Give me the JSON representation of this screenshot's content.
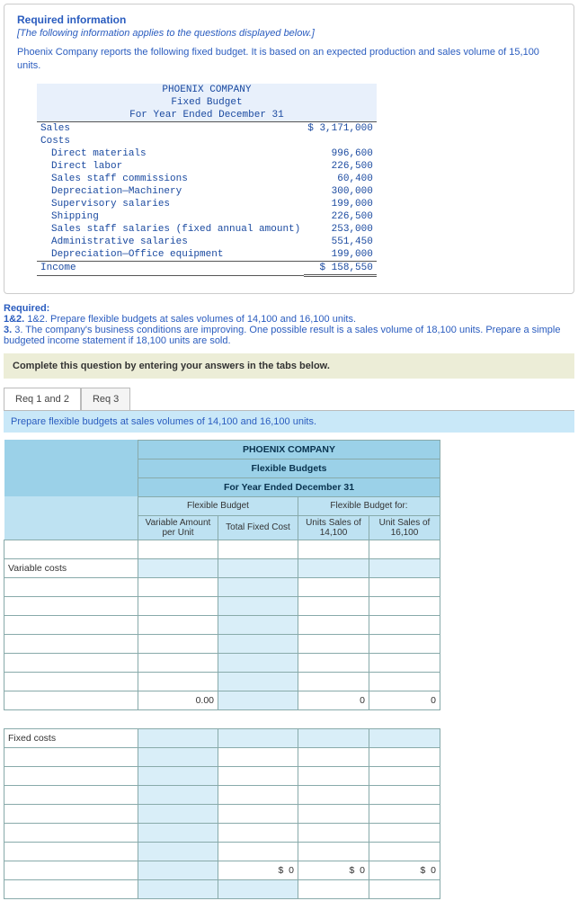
{
  "header": {
    "title": "Required information",
    "note": "[The following information applies to the questions displayed below.]",
    "intro": "Phoenix Company reports the following fixed budget. It is based on an expected production and sales volume of 15,100 units."
  },
  "fixed_budget": {
    "company": "PHOENIX COMPANY",
    "title": "Fixed Budget",
    "period": "For Year Ended December 31",
    "lines": {
      "sales_label": "Sales",
      "sales_amount": "$ 3,171,000",
      "costs_label": "Costs",
      "direct_materials": "Direct materials",
      "direct_materials_amt": "996,600",
      "direct_labor": "Direct labor",
      "direct_labor_amt": "226,500",
      "sales_staff_comm": "Sales staff commissions",
      "sales_staff_comm_amt": "60,400",
      "dep_machinery": "Depreciation—Machinery",
      "dep_machinery_amt": "300,000",
      "supervisory": "Supervisory salaries",
      "supervisory_amt": "199,000",
      "shipping": "Shipping",
      "shipping_amt": "226,500",
      "sales_staff_sal": "Sales staff salaries (fixed annual amount)",
      "sales_staff_sal_amt": "253,000",
      "admin_sal": "Administrative salaries",
      "admin_sal_amt": "551,450",
      "dep_office": "Depreciation—Office equipment",
      "dep_office_amt": "199,000",
      "income_label": "Income",
      "income_amt": "$ 158,550"
    }
  },
  "required": {
    "heading": "Required:",
    "line1": "1&2. Prepare flexible budgets at sales volumes of 14,100 and 16,100 units.",
    "line2": "3. The company's business conditions are improving. One possible result is a sales volume of 18,100 units. Prepare a simple budgeted income statement if 18,100 units are sold."
  },
  "instruction": "Complete this question by entering your answers in the tabs below.",
  "tabs": {
    "t1": "Req 1 and 2",
    "t2": "Req 3"
  },
  "prompt": "Prepare flexible budgets at sales volumes of 14,100 and 16,100 units.",
  "sheet": {
    "company": "PHOENIX COMPANY",
    "title": "Flexible Budgets",
    "period": "For Year Ended December 31",
    "col_group1": "Flexible Budget",
    "col_group2": "Flexible Budget for:",
    "col_a": "Variable Amount per Unit",
    "col_b": "Total Fixed Cost",
    "col_c": "Units Sales of 14,100",
    "col_d": "Unit Sales of 16,100",
    "variable_costs": "Variable costs",
    "fixed_costs": "Fixed costs",
    "zero_var": "0.00",
    "zero": "0",
    "dollar": "$"
  }
}
